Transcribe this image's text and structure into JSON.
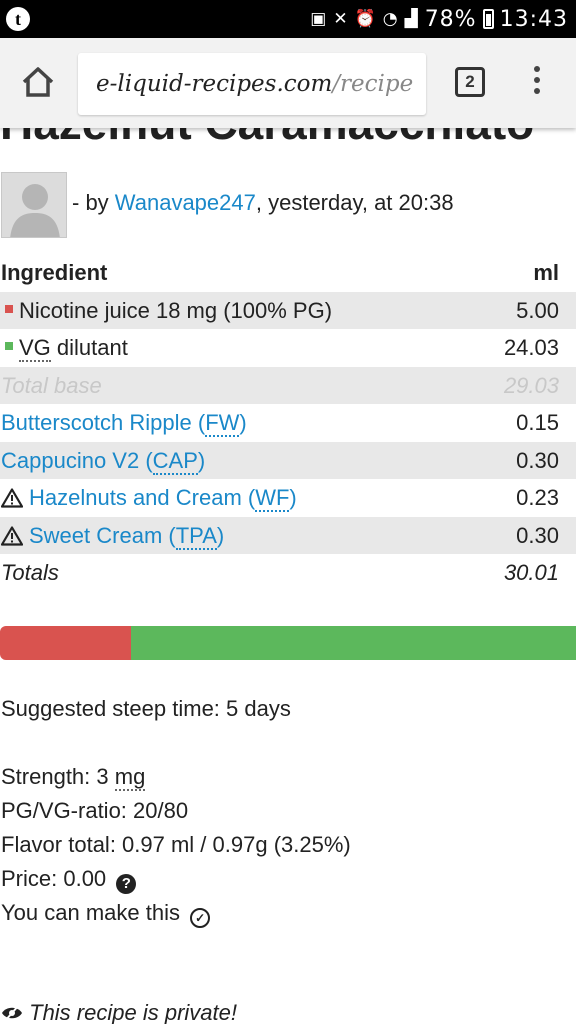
{
  "status_bar": {
    "battery": "78%",
    "time": "13:43"
  },
  "browser": {
    "url_domain": "e-liquid-recipes.com",
    "url_path": "/recipe",
    "tab_count": "2"
  },
  "recipe": {
    "title": "Hazelnut Caramacchiato",
    "byline_prefix": "- by ",
    "author": "Wanavape247",
    "byline_suffix": ", yesterday, at 20:38"
  },
  "table": {
    "header_ingredient": "Ingredient",
    "header_ml": "ml",
    "nicotine": {
      "label": "Nicotine juice 18 mg (100% PG)",
      "ml": "5.00",
      "color": "#d9534f"
    },
    "vg": {
      "abbr": "VG",
      "label": " dilutant",
      "ml": "24.03",
      "color": "#5cb85c"
    },
    "total_base": {
      "label": "Total base",
      "ml": "29.03"
    },
    "flavors": [
      {
        "name": "Butterscotch Ripple (",
        "abbr": "FW",
        "close": ")",
        "ml": "0.15",
        "warning": false
      },
      {
        "name": "Cappucino V2 (",
        "abbr": "CAP",
        "close": ")",
        "ml": "0.30",
        "warning": false
      },
      {
        "name": "Hazelnuts and Cream (",
        "abbr": "WF",
        "close": ")",
        "ml": "0.23",
        "warning": true
      },
      {
        "name": "Sweet Cream (",
        "abbr": "TPA",
        "close": ")",
        "ml": "0.30",
        "warning": true
      }
    ],
    "totals": {
      "label": "Totals",
      "ml": "30.01"
    }
  },
  "ratio_bar": {
    "pg_fraction": 0.2273,
    "pg_color": "#d9534f",
    "vg_color": "#5cb85c"
  },
  "info": {
    "steep": "Suggested steep time: 5 days",
    "strength_prefix": "Strength: 3 ",
    "strength_unit": "mg",
    "ratio": "PG/VG-ratio: 20/80",
    "flavor_total": "Flavor total: 0.97 ml / 0.97g (3.25%)",
    "price": "Price: 0.00",
    "make": "You can make this",
    "private": "This recipe is private!"
  }
}
